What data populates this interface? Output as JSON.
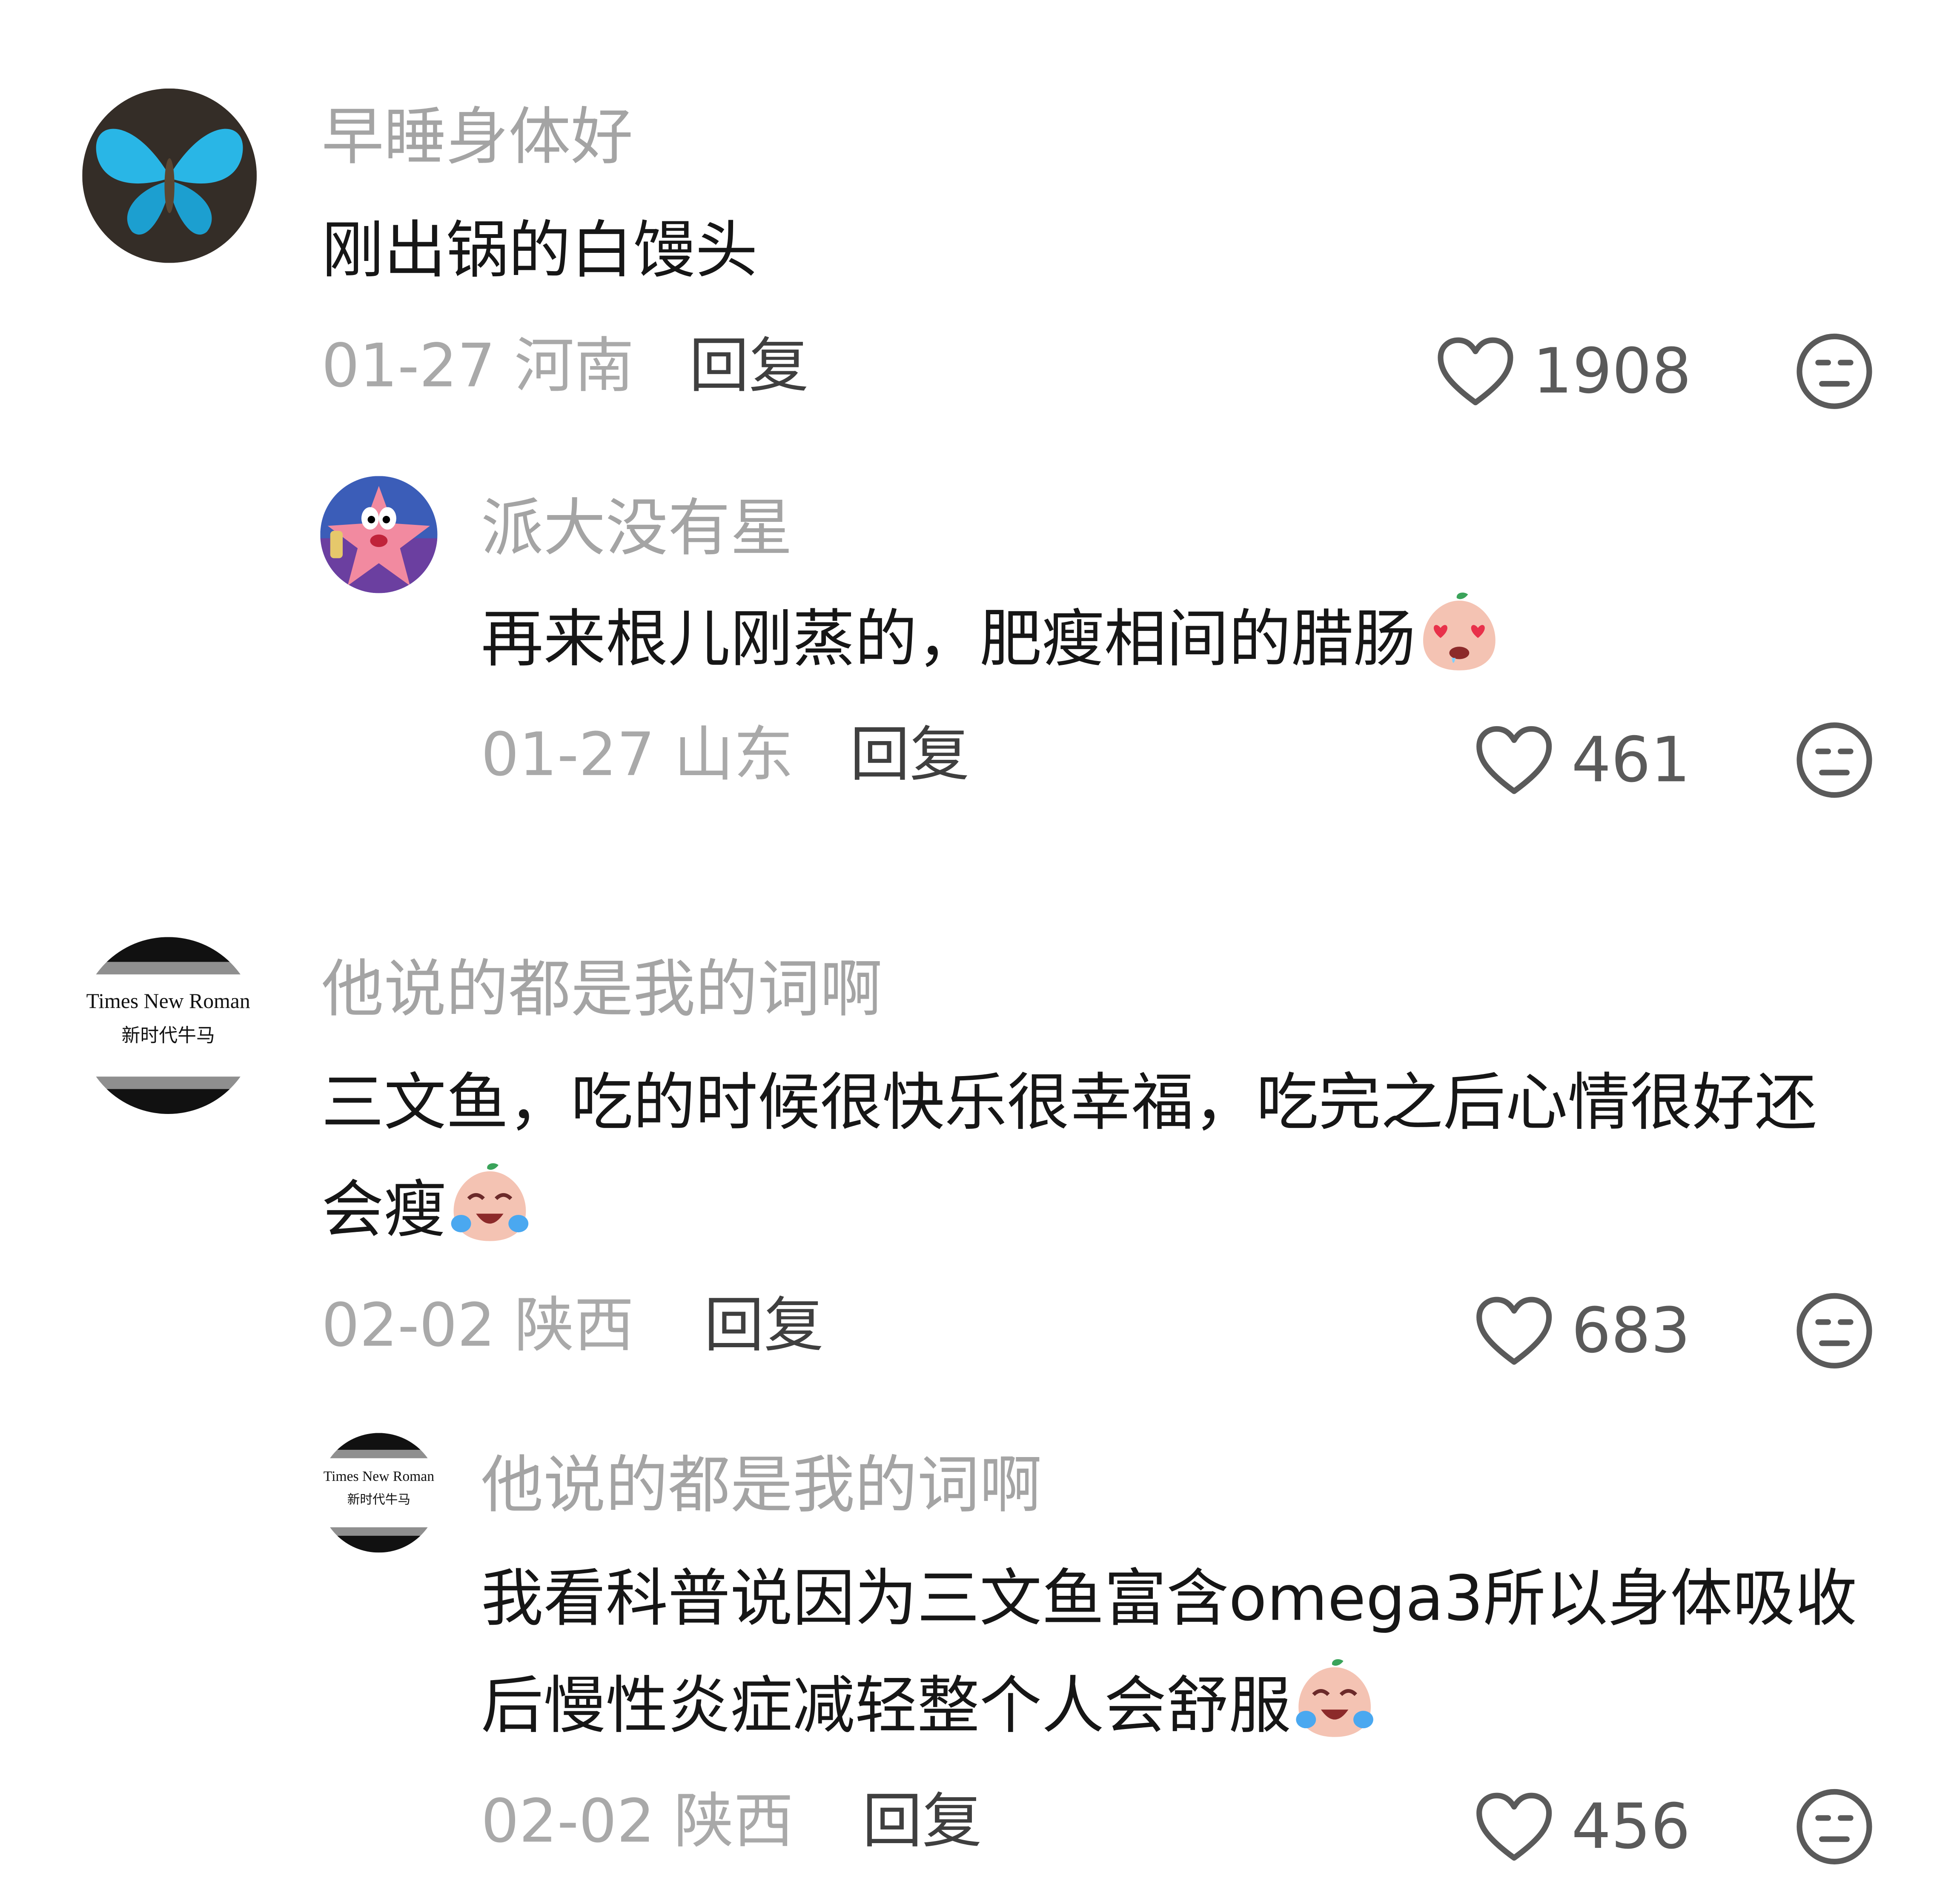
{
  "comments": [
    {
      "user": "早睡身体好",
      "text": "刚出锅的白馒头",
      "date": "01-27",
      "location": "河南",
      "reply_label": "回复",
      "likes": "1908",
      "avatar": "blue-butterfly-avatar"
    },
    {
      "user": "派大没有星",
      "text": "再来根儿刚蒸的，肥瘦相间的腊肠",
      "emoji": "heart-eyes-drool-emoji",
      "date": "01-27",
      "location": "山东",
      "reply_label": "回复",
      "likes": "461",
      "avatar": "patrick-star-avatar"
    },
    {
      "user": "他说的都是我的词啊",
      "text": "三文鱼，吃的时候很快乐很幸福，吃完之后心情很好还会瘦",
      "emoji": "crying-laughing-emoji",
      "date": "02-02",
      "location": "陕西",
      "reply_label": "回复",
      "likes": "683",
      "avatar": "times-new-roman-avatar",
      "avatar_text": [
        "Times New Roman",
        "新时代牛马"
      ]
    },
    {
      "user": "他说的都是我的词啊",
      "text": "我看科普说因为三文鱼富含omega3所以身体吸收后慢性炎症减轻整个人会舒服",
      "emoji": "crying-laughing-emoji",
      "date": "02-02",
      "location": "陕西",
      "reply_label": "回复",
      "likes": "456",
      "avatar": "times-new-roman-avatar",
      "avatar_text": [
        "Times New Roman",
        "新时代牛马"
      ]
    }
  ],
  "colors": {
    "username": "#a4a4a4",
    "text": "#161616",
    "meta": "#a9a9a9",
    "reply": "#3f3f3f",
    "icon": "#5a5a5a"
  }
}
